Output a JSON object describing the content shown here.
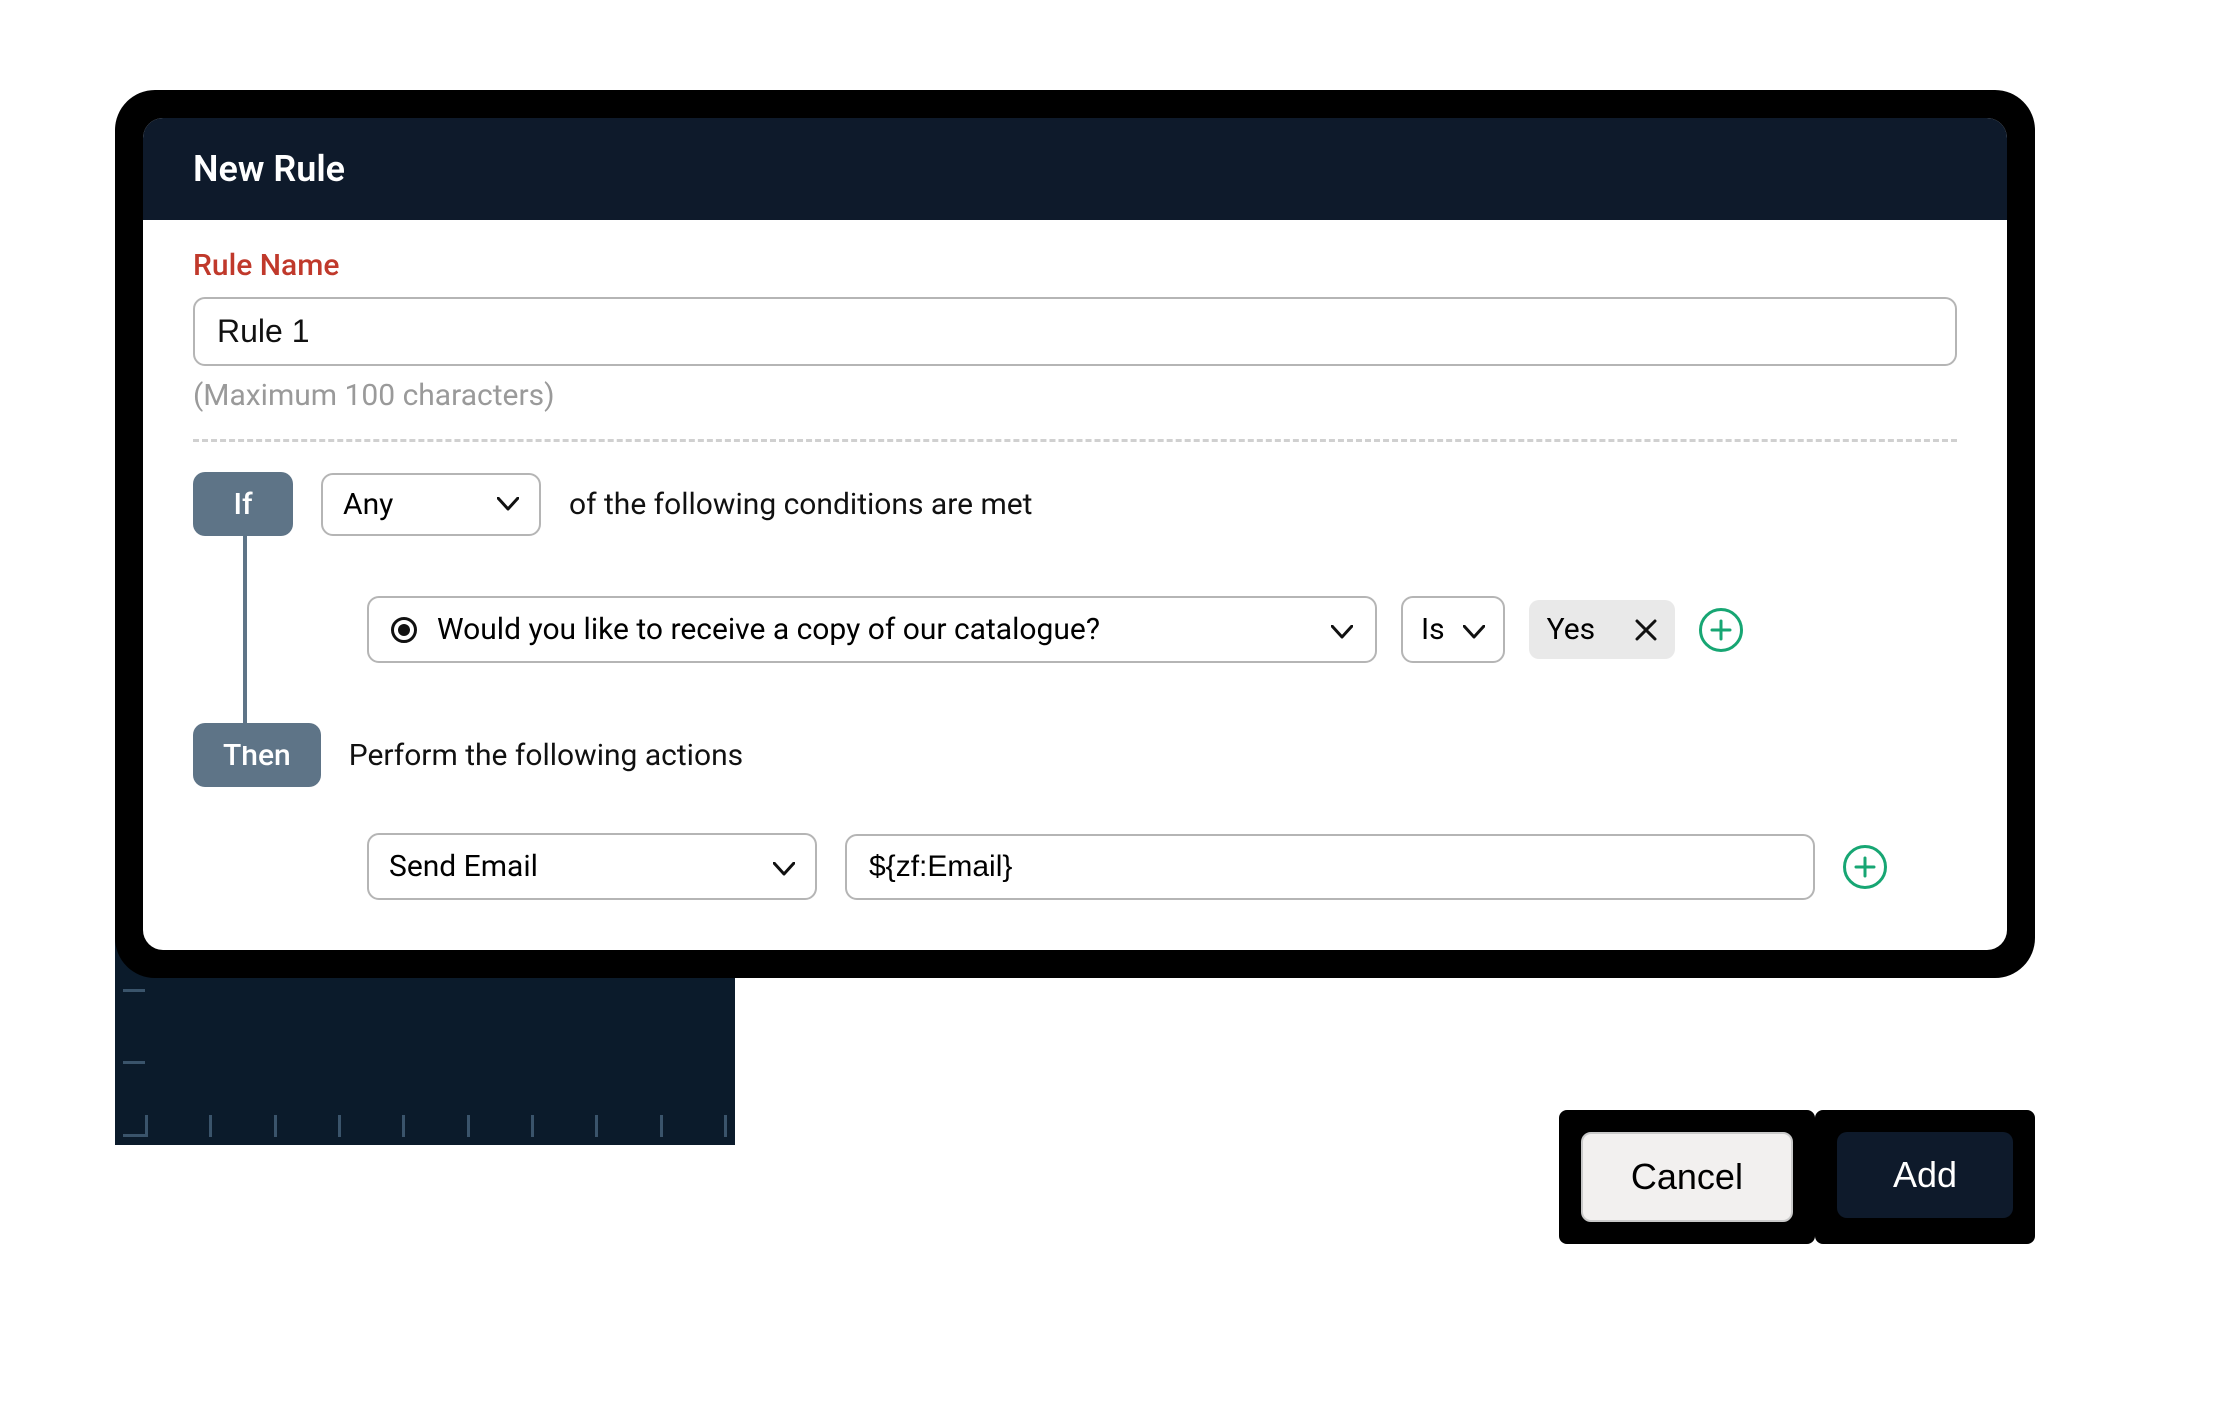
{
  "modal": {
    "title": "New Rule",
    "rule_name_label": "Rule Name",
    "rule_name_value": "Rule 1",
    "rule_name_helper": "(Maximum 100 characters)"
  },
  "if_block": {
    "badge": "If",
    "match_mode": "Any",
    "tail_text": "of the following conditions are met",
    "condition": {
      "field_label": "Would you like to receive a copy of our catalogue?",
      "operator": "Is",
      "value": "Yes"
    }
  },
  "then_block": {
    "badge": "Then",
    "intro_text": "Perform the following actions",
    "action_type": "Send Email",
    "action_value": "${zf:Email}"
  },
  "buttons": {
    "cancel": "Cancel",
    "add": "Add"
  }
}
